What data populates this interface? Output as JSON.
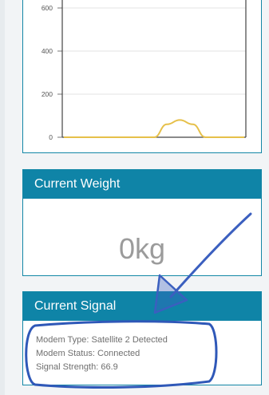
{
  "chart_data": {
    "type": "area",
    "y_ticks": [
      "600",
      "400",
      "200",
      "0"
    ],
    "ylim": [
      0,
      600
    ],
    "grid": true,
    "series": [
      {
        "color": "#e6c04a",
        "x": [
          0,
          1,
          2,
          3,
          4,
          5,
          6,
          7,
          8,
          9,
          10,
          11,
          12,
          13,
          14
        ],
        "values": [
          0,
          0,
          0,
          0,
          0,
          0,
          0,
          0,
          60,
          80,
          60,
          0,
          0,
          0,
          0
        ]
      }
    ]
  },
  "weight": {
    "title": "Current Weight",
    "value": "0kg"
  },
  "signal": {
    "title": "Current Signal",
    "modem_type": "Modem Type: Satellite 2 Detected",
    "modem_status": "Modem Status: Connected",
    "signal_strength": "Signal Strength: 66.9"
  },
  "colors": {
    "header": "#0f84a7",
    "border": "#1387a6",
    "annotation": "#3b5fbf"
  }
}
